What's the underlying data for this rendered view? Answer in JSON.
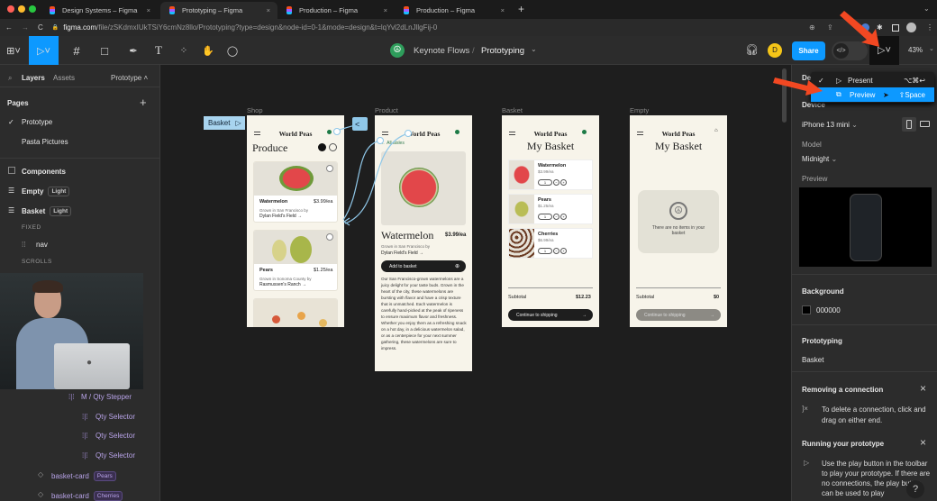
{
  "browser": {
    "tabs": [
      {
        "title": "Design Systems – Figma"
      },
      {
        "title": "Prototyping – Figma",
        "active": true
      },
      {
        "title": "Production – Figma"
      },
      {
        "title": "Production – Figma"
      }
    ],
    "url_host": "figma.com",
    "url_path": "/file/zSKdmxIUkTSiY6cmNz8llo/Prototyping?type=design&node-id=0-1&mode=design&t=lqYvl2dLnJllgFij-0"
  },
  "toolbar": {
    "team": "Keynote Flows",
    "file": "Prototyping",
    "avatar": "D",
    "share_label": "Share",
    "zoom": "43%",
    "colors": {
      "accent": "#0d99ff",
      "avatar": "#f5c518",
      "arrow": "#f24822"
    }
  },
  "present_menu": {
    "items": [
      {
        "label": "Present",
        "shortcut": "⌥⌘↩",
        "checked": true
      },
      {
        "label": "Preview",
        "shortcut": "⇧Space",
        "highlighted": true
      }
    ]
  },
  "left_panel": {
    "tabs": [
      "Layers",
      "Assets"
    ],
    "page_selector": "Prototype",
    "pages_heading": "Pages",
    "pages": [
      "Prototype",
      "Pasta Pictures"
    ],
    "layers": [
      {
        "label": "Components"
      },
      {
        "label": "Empty",
        "badge": "Light"
      },
      {
        "label": "Basket",
        "badge": "Light"
      },
      {
        "label": "FIXED"
      },
      {
        "label": "nav"
      },
      {
        "label": "SCROLLS"
      },
      {
        "label": "M / Qty Stepper"
      },
      {
        "label": "Qty Selector"
      },
      {
        "label": "Qty Selector"
      },
      {
        "label": "Qty Selector"
      },
      {
        "label": "basket-card",
        "badge": "Pears"
      },
      {
        "label": "basket-card",
        "badge": "Cherries"
      }
    ]
  },
  "canvas": {
    "flow_tag": "Basket",
    "brand": "World Peas",
    "frames": {
      "shop": {
        "label": "Shop",
        "title": "Produce",
        "products": [
          {
            "name": "Watermelon",
            "price": "$3.99/ea",
            "origin": "Grown in San Francisco by",
            "farm": "Dylan Field's Field →"
          },
          {
            "name": "Pears",
            "price": "$1.25/ea",
            "origin": "Grown in Sonoma County by",
            "farm": "Rasmussen's Ranch →"
          }
        ]
      },
      "product": {
        "label": "Product",
        "back": "← All aisles",
        "name": "Watermelon",
        "price": "$3.99/ea",
        "origin": "Grown in San Francisco by",
        "farm": "Dylan Field's Field →",
        "cta": "Add to basket",
        "description": "Our San Francisco-grown watermelons are a juicy delight for your taste buds. Grown in the heart of the city, these watermelons are bursting with flavor and have a crisp texture that is unmatched. Each watermelon is carefully hand-picked at the peak of ripeness to ensure maximum flavor and freshness. Whether you enjoy them as a refreshing snack on a hot day, in a delicious watermelon salad, or as a centerpiece for your next summer gathering, these watermelons are sure to impress."
      },
      "basket": {
        "label": "Basket",
        "title": "My Basket",
        "items": [
          {
            "name": "Watermelon",
            "price": "$3.99/ea",
            "qty": "1"
          },
          {
            "name": "Pears",
            "price": "$1.25/ea",
            "qty": "1"
          },
          {
            "name": "Cherries",
            "price": "$6.99/ea",
            "qty": "1"
          }
        ],
        "subtotal_label": "Subtotal",
        "subtotal": "$12.23",
        "cta": "Continue to shipping"
      },
      "empty": {
        "label": "Empty",
        "title": "My Basket",
        "empty_text": "There are no items in your basket",
        "subtotal_label": "Subtotal",
        "subtotal": "$0",
        "cta": "Continue to shipping"
      }
    }
  },
  "right_panel": {
    "device_heading": "Device",
    "device": "iPhone 13 mini",
    "model_label": "Model",
    "model": "Midnight",
    "preview_label": "Preview",
    "background_label": "Background",
    "background_value": "000000",
    "prototyping_label": "Prototyping",
    "flow": "Basket",
    "tips": [
      {
        "title": "Removing a connection",
        "text": "To delete a connection, click and drag on either end."
      },
      {
        "title": "Running your prototype",
        "text": "Use the play button in the toolbar to play your prototype. If there are no connections, the play button can be used to play"
      }
    ],
    "help": "?"
  }
}
